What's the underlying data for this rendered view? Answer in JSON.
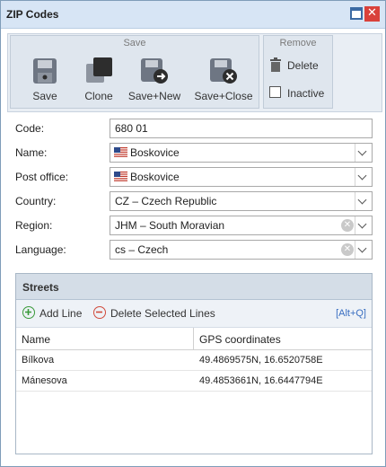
{
  "window": {
    "title": "ZIP Codes"
  },
  "ribbon": {
    "save_group": {
      "label": "Save",
      "buttons": [
        {
          "label": "Save",
          "icon": "save-icon"
        },
        {
          "label": "Clone",
          "icon": "clone-icon"
        },
        {
          "label": "Save+New",
          "icon": "save-new-icon"
        },
        {
          "label": "Save+Close",
          "icon": "save-close-icon"
        }
      ]
    },
    "remove_group": {
      "label": "Remove",
      "delete_label": "Delete",
      "inactive_label": "Inactive",
      "inactive_checked": false
    }
  },
  "form": {
    "code": {
      "label": "Code:",
      "value": "680 01"
    },
    "name": {
      "label": "Name:",
      "value": "Boskovice"
    },
    "post_office": {
      "label": "Post office:",
      "value": "Boskovice"
    },
    "country": {
      "label": "Country:",
      "value": "CZ – Czech Republic"
    },
    "region": {
      "label": "Region:",
      "value": "JHM – South Moravian"
    },
    "language": {
      "label": "Language:",
      "value": "cs – Czech"
    }
  },
  "streets": {
    "title": "Streets",
    "add_line": "Add Line",
    "delete_lines": "Delete Selected Lines",
    "shortcut": "[Alt+Q]",
    "columns": [
      "Name",
      "GPS coordinates"
    ],
    "rows": [
      {
        "name": "Bílkova",
        "gps": "49.4869575N, 16.6520758E"
      },
      {
        "name": "Mánesova",
        "gps": "49.4853661N, 16.6447794E"
      }
    ]
  },
  "colors": {
    "accent": "#3b6aa3",
    "close": "#d9413a",
    "add": "#3a9a3a",
    "delete": "#d14a3b"
  }
}
